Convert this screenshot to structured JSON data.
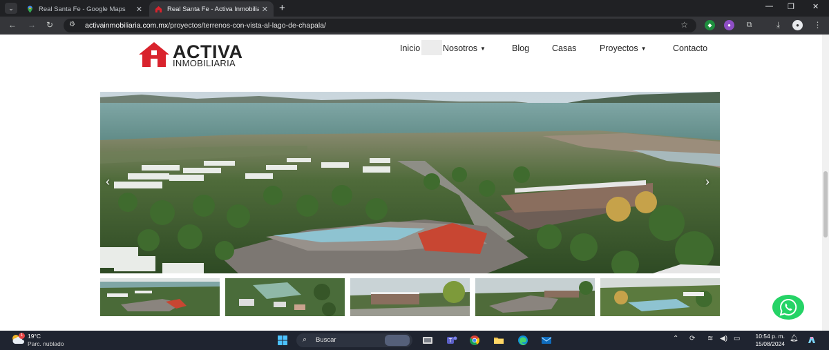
{
  "browser": {
    "tab_menu_icon": "chevron-down-icon",
    "tabs": [
      {
        "title": "Real Santa Fe - Google Maps",
        "icon": "google-maps-pin-icon",
        "active": false
      },
      {
        "title": "Real Santa Fe - Activa Inmobiliaria",
        "icon": "activa-house-icon",
        "active": true
      }
    ],
    "new_tab_glyph": "+",
    "window_controls": {
      "minimize": "—",
      "restore": "❐",
      "close": "✕"
    },
    "nav": {
      "back": "←",
      "forward": "→",
      "reload": "↻"
    },
    "url_host": "activainmobiliaria.com.mx",
    "url_path": "/proyectos/terrenos-con-vista-al-lago-de-chapala/",
    "extensions": [
      "shield-extension-icon",
      "color-extension-icon",
      "puzzle-extensions-icon",
      "download-icon",
      "profile-avatar-icon",
      "kebab-menu-icon"
    ]
  },
  "site": {
    "logo": {
      "word": "ACTIVA",
      "sub": "INMOBILIARIA",
      "brand_color": "#d9232d"
    },
    "nav": [
      {
        "label": "Inicio",
        "has_dropdown": false
      },
      {
        "label": "Nosotros",
        "has_dropdown": true
      },
      {
        "label": "Blog",
        "has_dropdown": false
      },
      {
        "label": "Casas",
        "has_dropdown": false
      },
      {
        "label": "Proyectos",
        "has_dropdown": true
      },
      {
        "label": "Contacto",
        "has_dropdown": false
      }
    ],
    "dropdown_caret": "▼",
    "slider": {
      "prev": "‹",
      "next": "›",
      "thumbnail_count": 5
    },
    "whatsapp_color": "#25d366"
  },
  "taskbar": {
    "weather": {
      "temp": "19°C",
      "desc": "Parc. nublado",
      "badge": "1"
    },
    "search_label": "Buscar",
    "pinned": [
      "windows-start-icon",
      "search-icon",
      "file-explorer-window-icon",
      "teams-icon",
      "chrome-icon",
      "folder-icon",
      "edge-icon",
      "mail-icon"
    ],
    "tray_icons": [
      "chevron-up-icon",
      "sync-icon",
      "onedrive-icon",
      "wifi-icon",
      "speaker-icon",
      "battery-icon"
    ],
    "time": "10:54 p. m.",
    "date": "15/08/2024"
  }
}
